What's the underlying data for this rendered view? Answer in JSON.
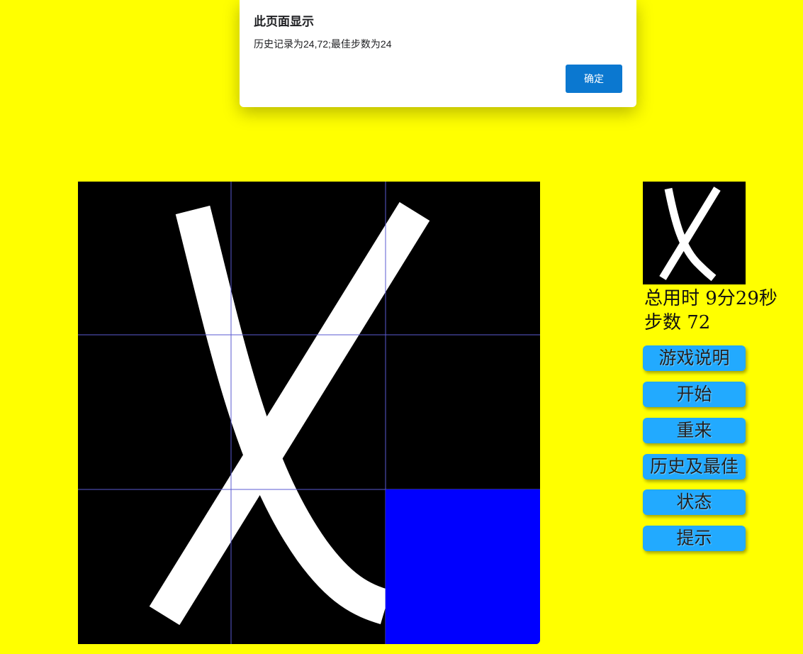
{
  "dialog": {
    "title": "此页面显示",
    "message": "历史记录为24,72;最佳步数为24",
    "ok_label": "确定"
  },
  "stats": {
    "time_label": "总用时 9分29秒",
    "steps_label": "步数 72"
  },
  "buttons": {
    "instructions": "游戏说明",
    "start": "开始",
    "restart": "重来",
    "history": "历史及最佳",
    "status": "状态",
    "hint": "提示"
  },
  "board": {
    "grid": "3x3",
    "image": "letter-x",
    "empty_tile_color": "#0000ff",
    "background_color": "#ffff00",
    "button_color": "#22aaff"
  }
}
